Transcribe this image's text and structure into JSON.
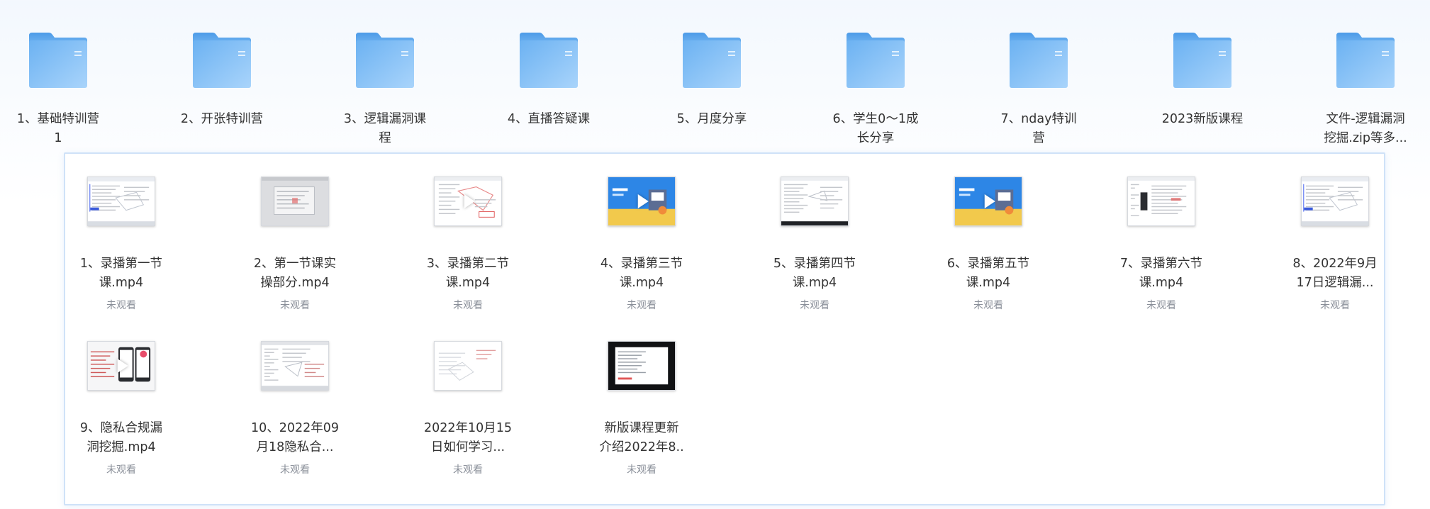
{
  "folders": [
    {
      "name": "1、基础特训营\n1"
    },
    {
      "name": "2、开张特训营"
    },
    {
      "name": "3、逻辑漏洞课\n程"
    },
    {
      "name": "4、直播答疑课"
    },
    {
      "name": "5、月度分享"
    },
    {
      "name": "6、学生0～1成\n长分享"
    },
    {
      "name": "7、nday特训\n营"
    },
    {
      "name": "2023新版课程"
    },
    {
      "name": "文件-逻辑漏洞\n挖掘.zip等多..."
    }
  ],
  "files": [
    {
      "name": "1、录播第一节\n课.mp4",
      "status": "未观看",
      "thumb": "doc-blue"
    },
    {
      "name": "2、第一节课实\n操部分.mp4",
      "status": "未观看",
      "thumb": "gray-app"
    },
    {
      "name": "3、录播第二节\n课.mp4",
      "status": "未观看",
      "thumb": "doc-play"
    },
    {
      "name": "4、录播第三节\n课.mp4",
      "status": "未观看",
      "thumb": "slide-play"
    },
    {
      "name": "5、录播第四节\n课.mp4",
      "status": "未观看",
      "thumb": "doc-dark"
    },
    {
      "name": "6、录播第五节\n课.mp4",
      "status": "未观看",
      "thumb": "slide-play"
    },
    {
      "name": "7、录播第六节\n课.mp4",
      "status": "未观看",
      "thumb": "doc-side"
    },
    {
      "name": "8、2022年9月\n17日逻辑漏...",
      "status": "未观看",
      "thumb": "doc-blue"
    },
    {
      "name": "9、隐私合规漏\n洞挖掘.mp4",
      "status": "未观看",
      "thumb": "phone-play"
    },
    {
      "name": "10、2022年09\n月18隐私合...",
      "status": "未观看",
      "thumb": "doc-plain"
    },
    {
      "name": "2022年10月15\n日如何学习...",
      "status": "未观看",
      "thumb": "doc-faint"
    },
    {
      "name": "新版课程更新\n介绍2022年8..",
      "status": "未观看",
      "thumb": "black-doc"
    }
  ]
}
